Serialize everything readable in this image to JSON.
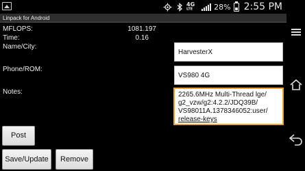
{
  "status_bar": {
    "left_icon": "image-notification-icon",
    "icons": [
      "gps-icon",
      "bluetooth-icon",
      "4g-lte-icon",
      "signal-icon"
    ],
    "network_label": "4G LTE",
    "battery_percent": "28%",
    "battery_level": 0.28,
    "time": "2:55 PM"
  },
  "app": {
    "title": "Linpack for Android"
  },
  "results": {
    "mflops_label": "MFLOPS:",
    "mflops_value": "1081.197",
    "time_label": "Time:",
    "time_value": "0.16"
  },
  "form": {
    "name_label": "Name/City:",
    "name_value": "HarvesterX",
    "phone_label": "Phone/ROM:",
    "phone_value": "VS980 4G",
    "notes_label": "Notes:",
    "notes_line1": "2265.6MHz Multi-Thread lge/",
    "notes_line2": "g2_vzw/g2:4.2.2/JDQ39B/",
    "notes_line3": "VS98011A.1378346052:user/",
    "notes_line4": "release-keys"
  },
  "buttons": {
    "post": "Post",
    "save": "Save/Update",
    "remove": "Remove"
  },
  "navbar": {
    "icons": [
      "menu-icon",
      "home-icon",
      "back-icon"
    ]
  }
}
